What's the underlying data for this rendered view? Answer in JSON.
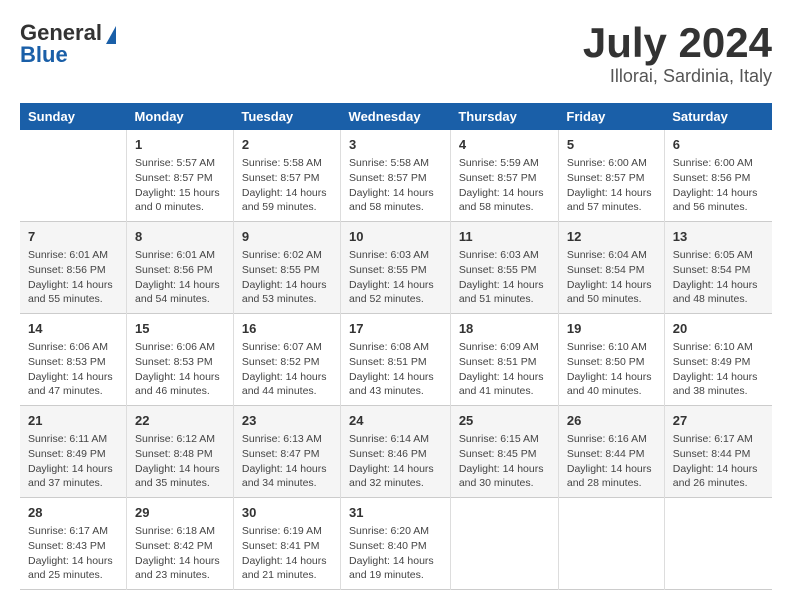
{
  "header": {
    "logo_general": "General",
    "logo_blue": "Blue",
    "title": "July 2024",
    "subtitle": "Illorai, Sardinia, Italy"
  },
  "weekdays": [
    "Sunday",
    "Monday",
    "Tuesday",
    "Wednesday",
    "Thursday",
    "Friday",
    "Saturday"
  ],
  "weeks": [
    [
      {
        "day": "",
        "content": ""
      },
      {
        "day": "1",
        "content": "Sunrise: 5:57 AM\nSunset: 8:57 PM\nDaylight: 15 hours\nand 0 minutes."
      },
      {
        "day": "2",
        "content": "Sunrise: 5:58 AM\nSunset: 8:57 PM\nDaylight: 14 hours\nand 59 minutes."
      },
      {
        "day": "3",
        "content": "Sunrise: 5:58 AM\nSunset: 8:57 PM\nDaylight: 14 hours\nand 58 minutes."
      },
      {
        "day": "4",
        "content": "Sunrise: 5:59 AM\nSunset: 8:57 PM\nDaylight: 14 hours\nand 58 minutes."
      },
      {
        "day": "5",
        "content": "Sunrise: 6:00 AM\nSunset: 8:57 PM\nDaylight: 14 hours\nand 57 minutes."
      },
      {
        "day": "6",
        "content": "Sunrise: 6:00 AM\nSunset: 8:56 PM\nDaylight: 14 hours\nand 56 minutes."
      }
    ],
    [
      {
        "day": "7",
        "content": "Sunrise: 6:01 AM\nSunset: 8:56 PM\nDaylight: 14 hours\nand 55 minutes."
      },
      {
        "day": "8",
        "content": "Sunrise: 6:01 AM\nSunset: 8:56 PM\nDaylight: 14 hours\nand 54 minutes."
      },
      {
        "day": "9",
        "content": "Sunrise: 6:02 AM\nSunset: 8:55 PM\nDaylight: 14 hours\nand 53 minutes."
      },
      {
        "day": "10",
        "content": "Sunrise: 6:03 AM\nSunset: 8:55 PM\nDaylight: 14 hours\nand 52 minutes."
      },
      {
        "day": "11",
        "content": "Sunrise: 6:03 AM\nSunset: 8:55 PM\nDaylight: 14 hours\nand 51 minutes."
      },
      {
        "day": "12",
        "content": "Sunrise: 6:04 AM\nSunset: 8:54 PM\nDaylight: 14 hours\nand 50 minutes."
      },
      {
        "day": "13",
        "content": "Sunrise: 6:05 AM\nSunset: 8:54 PM\nDaylight: 14 hours\nand 48 minutes."
      }
    ],
    [
      {
        "day": "14",
        "content": "Sunrise: 6:06 AM\nSunset: 8:53 PM\nDaylight: 14 hours\nand 47 minutes."
      },
      {
        "day": "15",
        "content": "Sunrise: 6:06 AM\nSunset: 8:53 PM\nDaylight: 14 hours\nand 46 minutes."
      },
      {
        "day": "16",
        "content": "Sunrise: 6:07 AM\nSunset: 8:52 PM\nDaylight: 14 hours\nand 44 minutes."
      },
      {
        "day": "17",
        "content": "Sunrise: 6:08 AM\nSunset: 8:51 PM\nDaylight: 14 hours\nand 43 minutes."
      },
      {
        "day": "18",
        "content": "Sunrise: 6:09 AM\nSunset: 8:51 PM\nDaylight: 14 hours\nand 41 minutes."
      },
      {
        "day": "19",
        "content": "Sunrise: 6:10 AM\nSunset: 8:50 PM\nDaylight: 14 hours\nand 40 minutes."
      },
      {
        "day": "20",
        "content": "Sunrise: 6:10 AM\nSunset: 8:49 PM\nDaylight: 14 hours\nand 38 minutes."
      }
    ],
    [
      {
        "day": "21",
        "content": "Sunrise: 6:11 AM\nSunset: 8:49 PM\nDaylight: 14 hours\nand 37 minutes."
      },
      {
        "day": "22",
        "content": "Sunrise: 6:12 AM\nSunset: 8:48 PM\nDaylight: 14 hours\nand 35 minutes."
      },
      {
        "day": "23",
        "content": "Sunrise: 6:13 AM\nSunset: 8:47 PM\nDaylight: 14 hours\nand 34 minutes."
      },
      {
        "day": "24",
        "content": "Sunrise: 6:14 AM\nSunset: 8:46 PM\nDaylight: 14 hours\nand 32 minutes."
      },
      {
        "day": "25",
        "content": "Sunrise: 6:15 AM\nSunset: 8:45 PM\nDaylight: 14 hours\nand 30 minutes."
      },
      {
        "day": "26",
        "content": "Sunrise: 6:16 AM\nSunset: 8:44 PM\nDaylight: 14 hours\nand 28 minutes."
      },
      {
        "day": "27",
        "content": "Sunrise: 6:17 AM\nSunset: 8:44 PM\nDaylight: 14 hours\nand 26 minutes."
      }
    ],
    [
      {
        "day": "28",
        "content": "Sunrise: 6:17 AM\nSunset: 8:43 PM\nDaylight: 14 hours\nand 25 minutes."
      },
      {
        "day": "29",
        "content": "Sunrise: 6:18 AM\nSunset: 8:42 PM\nDaylight: 14 hours\nand 23 minutes."
      },
      {
        "day": "30",
        "content": "Sunrise: 6:19 AM\nSunset: 8:41 PM\nDaylight: 14 hours\nand 21 minutes."
      },
      {
        "day": "31",
        "content": "Sunrise: 6:20 AM\nSunset: 8:40 PM\nDaylight: 14 hours\nand 19 minutes."
      },
      {
        "day": "",
        "content": ""
      },
      {
        "day": "",
        "content": ""
      },
      {
        "day": "",
        "content": ""
      }
    ]
  ]
}
